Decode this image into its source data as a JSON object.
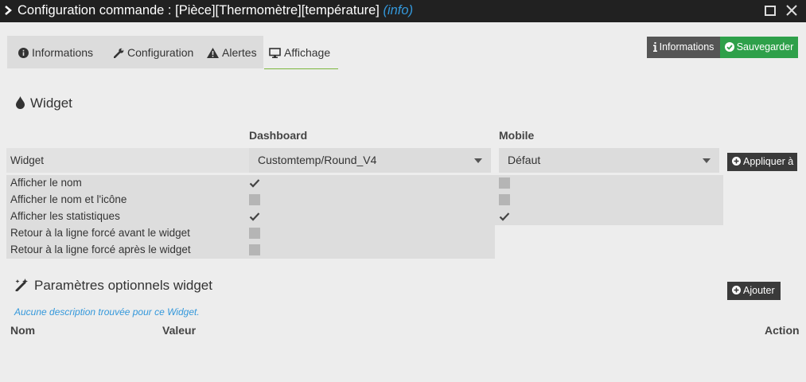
{
  "window": {
    "title": "Configuration commande : [Pièce][Thermomètre][température]",
    "type_tag": "(info)"
  },
  "tabs": [
    {
      "label": "Informations",
      "icon": "info-circle-icon"
    },
    {
      "label": "Configuration",
      "icon": "wrench-icon"
    },
    {
      "label": "Alertes",
      "icon": "warning-icon"
    },
    {
      "label": "Affichage",
      "icon": "desktop-icon",
      "active": true
    }
  ],
  "actions": {
    "info_label": "Informations",
    "save_label": "Sauvegarder"
  },
  "widget_section": {
    "title": "Widget",
    "col_dashboard": "Dashboard",
    "col_mobile": "Mobile",
    "widget_label": "Widget",
    "dashboard_select": "Customtemp/Round_V4",
    "mobile_select": "Défaut",
    "apply_label": "Appliquer à",
    "rows": [
      {
        "label": "Afficher le nom",
        "dashboard": true,
        "mobile": false
      },
      {
        "label": "Afficher le nom et l'icône",
        "dashboard": false,
        "mobile": false
      },
      {
        "label": "Afficher les statistiques",
        "dashboard": true,
        "mobile": true
      },
      {
        "label": "Retour à la ligne forcé avant le widget",
        "dashboard": false
      },
      {
        "label": "Retour à la ligne forcé après le widget",
        "dashboard": false
      }
    ]
  },
  "params_section": {
    "title": "Paramètres optionnels widget",
    "add_label": "Ajouter",
    "empty_note": "Aucune description trouvée pour ce Widget.",
    "col_name": "Nom",
    "col_value": "Valeur",
    "col_action": "Action"
  },
  "colors": {
    "accent_green": "#2ea04a",
    "tab_underline": "#7bb63d",
    "link_blue": "#3498db",
    "titlebar": "#212121"
  }
}
